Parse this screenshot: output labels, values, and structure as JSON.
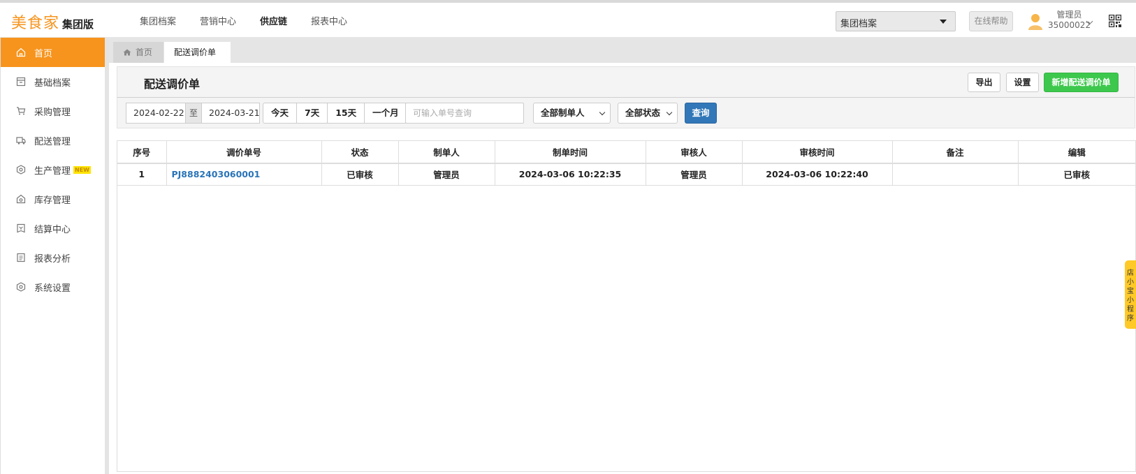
{
  "app": {
    "brand": "美食家",
    "edition": "集团版"
  },
  "topnav": [
    {
      "label": "集团档案",
      "active": false
    },
    {
      "label": "营销中心",
      "active": false
    },
    {
      "label": "供应链",
      "active": true
    },
    {
      "label": "报表中心",
      "active": false
    }
  ],
  "header": {
    "org_select": "集团档案",
    "help_label": "在线帮助",
    "user_role": "管理员",
    "user_id": "35000022"
  },
  "sidebar": {
    "items": [
      {
        "label": "首页",
        "icon": "home-icon"
      },
      {
        "label": "基础档案",
        "icon": "archive-icon"
      },
      {
        "label": "采购管理",
        "icon": "cart-icon"
      },
      {
        "label": "配送管理",
        "icon": "truck-icon"
      },
      {
        "label": "生产管理",
        "icon": "production-icon",
        "badge": "NEW"
      },
      {
        "label": "库存管理",
        "icon": "warehouse-icon"
      },
      {
        "label": "结算中心",
        "icon": "settlement-icon"
      },
      {
        "label": "报表分析",
        "icon": "report-icon"
      },
      {
        "label": "系统设置",
        "icon": "settings-icon"
      }
    ]
  },
  "tabs": {
    "home": "首页",
    "current": "配送调价单"
  },
  "panel": {
    "title": "配送调价单",
    "export_label": "导出",
    "settings_label": "设置",
    "new_label": "新增配送调价单"
  },
  "filters": {
    "date_from": "2024-02-22",
    "date_sep": "至",
    "date_to": "2024-03-21",
    "ranges": [
      "今天",
      "7天",
      "15天",
      "一个月"
    ],
    "search_placeholder": "可输入单号查询",
    "maker_select": "全部制单人",
    "status_select": "全部状态",
    "query_label": "查询"
  },
  "table": {
    "columns": [
      "序号",
      "调价单号",
      "状态",
      "制单人",
      "制单时间",
      "审核人",
      "审核时间",
      "备注",
      "编辑"
    ],
    "rows": [
      [
        "1",
        "PJ8882403060001",
        "已审核",
        "管理员",
        "2024-03-06 10:22:35",
        "管理员",
        "2024-03-06 10:22:40",
        "",
        "已审核"
      ]
    ]
  },
  "float_tab": "店小宝小程序",
  "colors": {
    "accent": "#f7941d",
    "primary": "#3278b8",
    "success": "#3dc84d",
    "link": "#2a74b8"
  }
}
